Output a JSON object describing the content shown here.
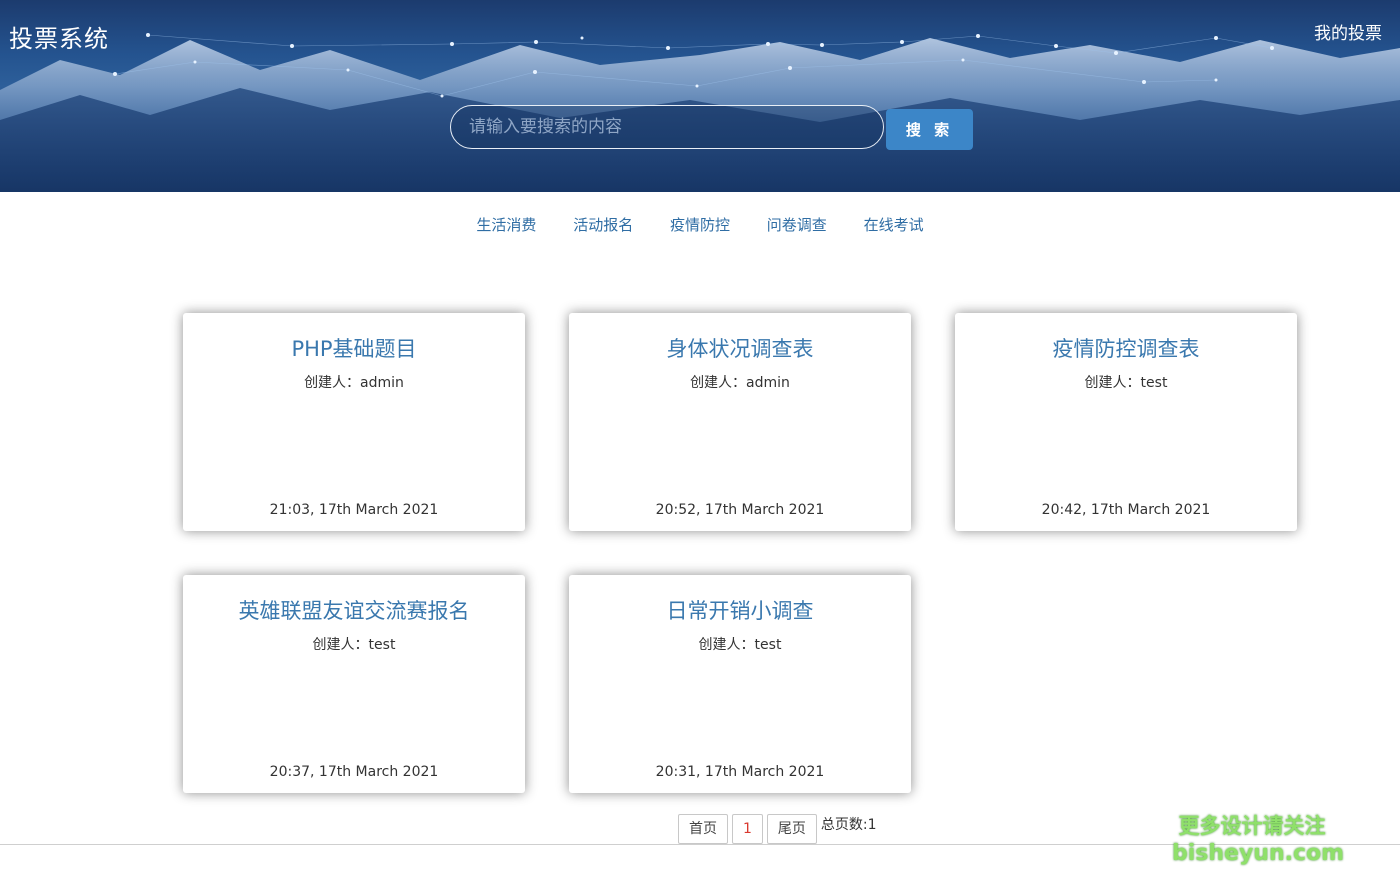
{
  "header": {
    "brand": "投票系统",
    "my_votes": "我的投票",
    "search_placeholder": "请输入要搜索的内容",
    "search_button": "搜 索"
  },
  "nav": {
    "items": [
      "生活消费",
      "活动报名",
      "疫情防控",
      "问卷调查",
      "在线考试"
    ]
  },
  "cards": [
    {
      "title": "PHP基础题目",
      "creator": "创建人：admin",
      "time": "21:03, 17th March 2021"
    },
    {
      "title": "身体状况调查表",
      "creator": "创建人：admin",
      "time": "20:52, 17th March 2021"
    },
    {
      "title": "疫情防控调查表",
      "creator": "创建人：test",
      "time": "20:42, 17th March 2021"
    },
    {
      "title": "英雄联盟友谊交流赛报名",
      "creator": "创建人：test",
      "time": "20:37, 17th March 2021"
    },
    {
      "title": "日常开销小调查",
      "creator": "创建人：test",
      "time": "20:31, 17th March 2021"
    }
  ],
  "pagination": {
    "first": "首页",
    "current": "1",
    "last": "尾页",
    "total": "总页数:1"
  },
  "watermark": {
    "line1": "更多设计请关注",
    "line2": "bisheyun.com"
  },
  "colors": {
    "accent_link": "#2f6da4",
    "card_title": "#3a78ae",
    "search_button": "#3c86c8",
    "current_page": "#d9392f",
    "watermark": "#8fe06a"
  }
}
